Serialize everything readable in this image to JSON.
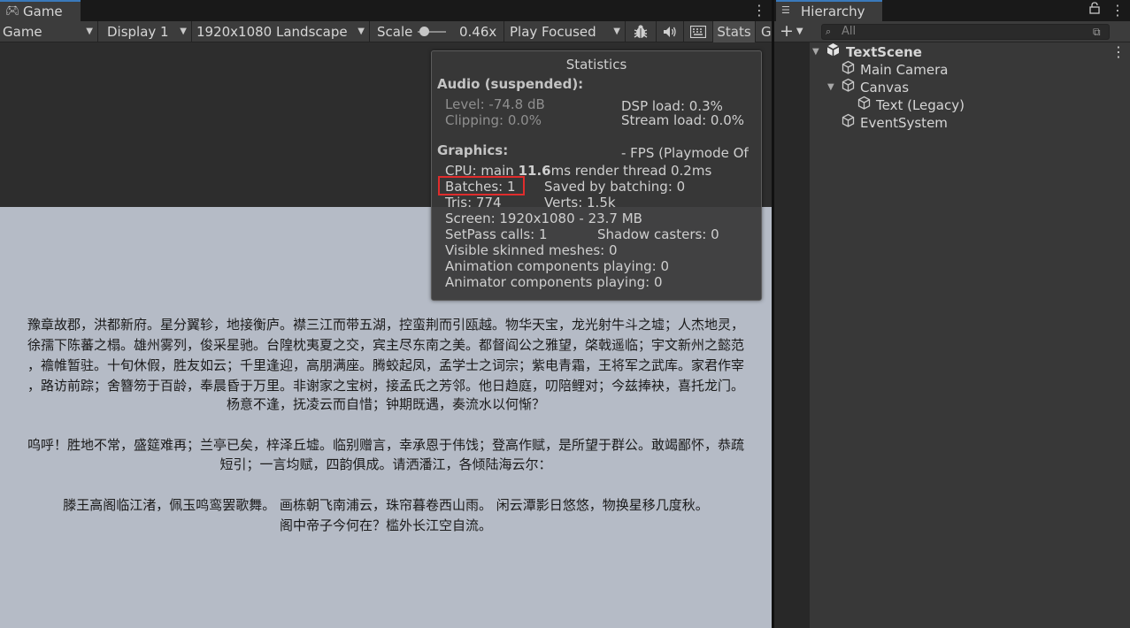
{
  "game": {
    "tab_label": "Game",
    "tab_icon": "gamepad-icon",
    "toolbar": {
      "mode_select": "Game",
      "display_select": "Display 1",
      "resolution_select": "1920x1080 Landscape",
      "scale_label": "Scale",
      "scale_value": "0.46x",
      "play_mode_select": "Play Focused",
      "stats_label": "Stats",
      "gizmos_label": "G"
    },
    "text_lines": [
      "豫章故郡，洪都新府。星分翼轸，地接衡庐。襟三江而带五湖，控蛮荆而引瓯越。物华天宝，龙光射牛斗之墟；人杰地灵，",
      "徐孺下陈蕃之榻。雄州雾列，俊采星驰。台隍枕夷夏之交，宾主尽东南之美。都督阎公之雅望，棨戟遥临；宇文新州之懿范",
      "，襜帷暂驻。十旬休假，胜友如云；千里逢迎，高朋满座。腾蛟起凤，孟学士之词宗；紫电青霜，王将军之武库。家君作宰",
      "，路访前踪；舍簪笏于百龄，奉晨昏于万里。非谢家之宝树，接孟氏之芳邻。他日趋庭，叨陪鲤对；今兹捧袂，喜托龙门。",
      "杨意不逢，抚凌云而自惜；钟期既遇，奏流水以何惭？",
      "",
      "呜呼！胜地不常，盛筵难再；兰亭已矣，梓泽丘墟。临别赠言，幸承恩于伟饯；登高作赋，是所望于群公。敢竭鄙怀，恭疏",
      "短引；一言均赋，四韵俱成。请洒潘江，各倾陆海云尔：",
      "",
      "滕王高阁临江渚，佩玉鸣鸾罢歌舞。 画栋朝飞南浦云，珠帘暮卷西山雨。 闲云潭影日悠悠，物换星移几度秋。",
      "阁中帝子今何在？槛外长江空自流。"
    ]
  },
  "statistics": {
    "title": "Statistics",
    "audio_header": "Audio (suspended):",
    "level": "Level: -74.8 dB",
    "clipping": "Clipping: 0.0%",
    "dsp_load": "DSP load: 0.3%",
    "stream_load": "Stream load: 0.0%",
    "graphics_header": "Graphics:",
    "fps": "- FPS (Playmode Off)",
    "cpu_prefix": "CPU: main ",
    "cpu_main": "11.6",
    "cpu_suffix": "ms  render thread 0.2ms",
    "batches": "Batches: 1",
    "saved_by_batching": "Saved by batching: 0",
    "tris": "Tris: 774",
    "verts": "Verts: 1.5k",
    "screen": "Screen: 1920x1080 - 23.7 MB",
    "setpass": "SetPass calls: 1",
    "shadow_casters": "Shadow casters: 0",
    "visible_skinned": "Visible skinned meshes: 0",
    "animation_components": "Animation components playing: 0",
    "animator_components": "Animator components playing: 0"
  },
  "hierarchy": {
    "tab_label": "Hierarchy",
    "search_placeholder": "All",
    "items": [
      {
        "label": "TextScene"
      },
      {
        "label": "Main Camera"
      },
      {
        "label": "Canvas"
      },
      {
        "label": "Text (Legacy)"
      },
      {
        "label": "EventSystem"
      }
    ]
  },
  "colors": {
    "highlight": "#e02c2c",
    "accent_tab": "#3a79bb",
    "game_view_bg": "#b5bbc6"
  }
}
